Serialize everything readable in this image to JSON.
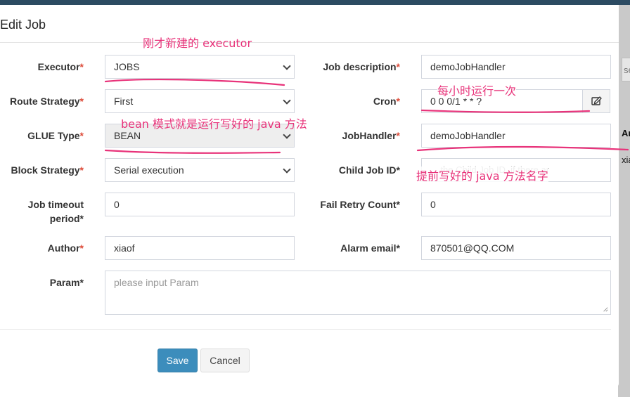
{
  "dialog": {
    "title": "Edit Job",
    "save_label": "Save",
    "cancel_label": "Cancel"
  },
  "fields": {
    "executor": {
      "label": "Executor",
      "value": "JOBS"
    },
    "job_description": {
      "label": "Job description",
      "value": "demoJobHandler"
    },
    "route_strategy": {
      "label": "Route Strategy",
      "value": "First"
    },
    "cron": {
      "label": "Cron",
      "value": "0 0 0/1 * * ?"
    },
    "glue_type": {
      "label": "GLUE Type",
      "value": "BEAN"
    },
    "job_handler": {
      "label": "JobHandler",
      "value": "demoJobHandler"
    },
    "block_strategy": {
      "label": "Block Strategy",
      "value": "Serial execution"
    },
    "child_job_id": {
      "label": "Child Job ID",
      "placeholder": "... the Child Job ID, if there ar"
    },
    "job_timeout": {
      "label_line1": "Job timeout",
      "label_line2": "period",
      "value": "0"
    },
    "fail_retry": {
      "label": "Fail Retry Count",
      "value": "0"
    },
    "author": {
      "label": "Author",
      "value": "xiaof"
    },
    "alarm_email": {
      "label": "Alarm email",
      "value": "870501@QQ.COM"
    },
    "param": {
      "label": "Param",
      "placeholder": "please input Param"
    }
  },
  "required_mark": "*",
  "annotations": {
    "executor_note": "刚才新建的 executor",
    "cron_note": "每小时运行一次",
    "glue_note": "bean 模式就是运行写好的 java 方法",
    "handler_note": "提前写好的 java 方法名字"
  },
  "background": {
    "input_fragment": "se",
    "fragment1": "Ar",
    "fragment2": "xia"
  },
  "icons": {
    "cron_button": "edit-icon",
    "dropdown": "chevron-down-icon"
  },
  "colors": {
    "primary": "#3c8dbc",
    "required": "#dd4b39",
    "annotation": "#e8337a",
    "top_bar": "#2c4b62"
  }
}
